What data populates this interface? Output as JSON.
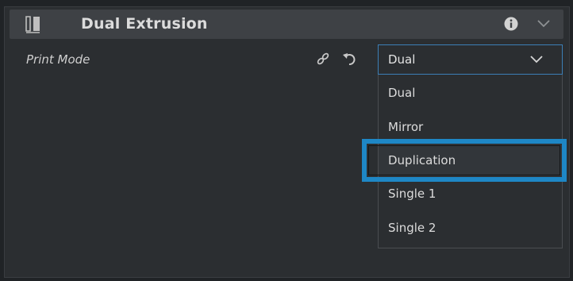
{
  "section": {
    "title": "Dual Extrusion",
    "icon": "dual-nozzle-icon"
  },
  "setting": {
    "label": "Print Mode",
    "selected_value": "Dual",
    "options": [
      {
        "label": "Dual"
      },
      {
        "label": "Mirror"
      },
      {
        "label": "Duplication"
      },
      {
        "label": "Single 1"
      },
      {
        "label": "Single 2"
      }
    ]
  },
  "colors": {
    "highlight": "#1e87c6",
    "select_border": "#3c7fb6"
  }
}
